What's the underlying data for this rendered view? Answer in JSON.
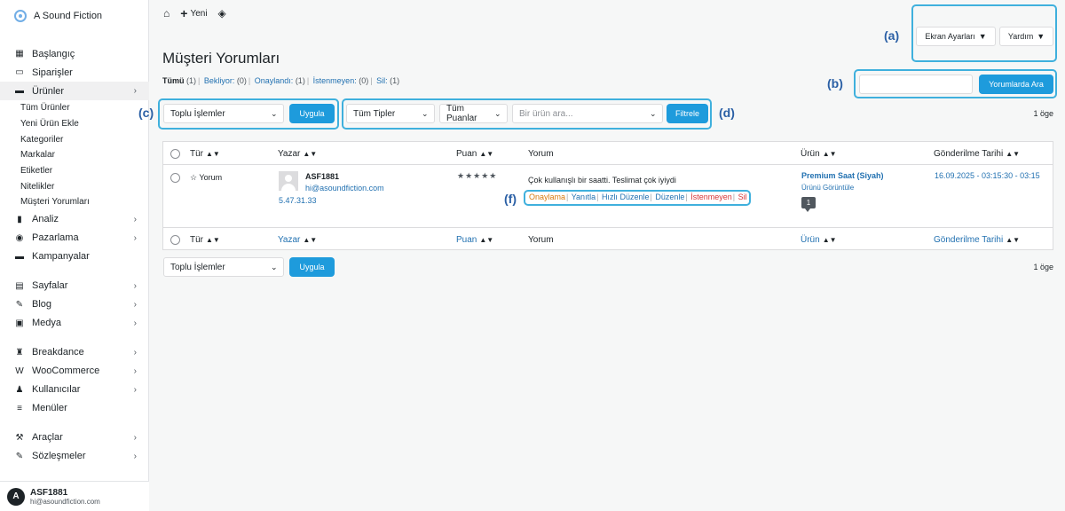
{
  "brand": {
    "name": "A Sound Fiction"
  },
  "sidebar": {
    "items": [
      {
        "label": "Başlangıç",
        "icon": "dashboard-icon",
        "glyph": "▦"
      },
      {
        "label": "Siparişler",
        "icon": "inbox-icon",
        "glyph": "▭"
      },
      {
        "label": "Ürünler",
        "icon": "archive-icon",
        "glyph": "▬"
      },
      {
        "label": "Analiz",
        "icon": "bar-chart-icon",
        "glyph": "▮"
      },
      {
        "label": "Pazarlama",
        "icon": "megaphone-icon",
        "glyph": "◉"
      },
      {
        "label": "Kampanyalar",
        "icon": "card-icon",
        "glyph": "▬"
      },
      {
        "label": "Sayfalar",
        "icon": "pages-icon",
        "glyph": "▤"
      },
      {
        "label": "Blog",
        "icon": "edit-icon",
        "glyph": "✎"
      },
      {
        "label": "Medya",
        "icon": "image-icon",
        "glyph": "▣"
      },
      {
        "label": "Breakdance",
        "icon": "breakdance-icon",
        "glyph": "♜"
      },
      {
        "label": "WooCommerce",
        "icon": "woocommerce-icon",
        "glyph": "W"
      },
      {
        "label": "Kullanıcılar",
        "icon": "users-icon",
        "glyph": "♟"
      },
      {
        "label": "Menüler",
        "icon": "menu-icon",
        "glyph": "≡"
      },
      {
        "label": "Araçlar",
        "icon": "wrench-icon",
        "glyph": "⚒"
      },
      {
        "label": "Sözleşmeler",
        "icon": "contract-icon",
        "glyph": "✎"
      }
    ],
    "submenu": [
      "Tüm Ürünler",
      "Yeni Ürün Ekle",
      "Kategoriler",
      "Markalar",
      "Etiketler",
      "Nitelikler",
      "Müşteri Yorumları"
    ]
  },
  "user": {
    "avatar_letter": "A",
    "name": "ASF1881",
    "email": "hi@asoundfiction.com"
  },
  "topbar": {
    "home_glyph": "⌂",
    "new_label": "Yeni",
    "breakdance_glyph": "◈"
  },
  "header_buttons": {
    "screen_options": "Ekran Ayarları",
    "help": "Yardım"
  },
  "page": {
    "title": "Müşteri Yorumları"
  },
  "status_links": {
    "all": "Tümü",
    "all_count": "(1)",
    "pending": "Bekliyor:",
    "pending_count": "(0)",
    "approved": "Onaylandı:",
    "approved_count": "(1)",
    "spam": "İstenmeyen:",
    "spam_count": "(0)",
    "trash": "Sil:",
    "trash_count": "(1)"
  },
  "search": {
    "placeholder": "",
    "button": "Yorumlarda Ara"
  },
  "bulk_actions": {
    "selected": "Toplu İşlemler",
    "apply": "Uygula"
  },
  "filters": {
    "type": "Tüm Tipler",
    "rating": "Tüm Puanlar",
    "product_placeholder": "Bir ürün ara...",
    "filter_button": "Filtrele"
  },
  "items_count": "1 öge",
  "annotations": {
    "a": "(a)",
    "b": "(b)",
    "c": "(c)",
    "d": "(d)",
    "f": "(f)"
  },
  "table": {
    "headers": {
      "type": "Tür",
      "author": "Yazar",
      "rating": "Puan",
      "review": "Yorum",
      "product": "Ürün",
      "date": "Gönderilme Tarihi"
    },
    "row": {
      "type": "☆ Yorum",
      "author_name": "ASF1881",
      "author_email": "hi@asoundfiction.com",
      "author_ip": "5.47.31.33",
      "rating": "★★★★★",
      "review_text": "Çok kullanışlı bir saatti. Teslimat çok iyiydi",
      "actions": {
        "approve": "Onaylama",
        "reply": "Yanıtla",
        "quick_edit": "Hızlı Düzenle",
        "edit": "Düzenle",
        "spam": "İstenmeyen",
        "trash": "Sil"
      },
      "product_name": "Premium Saat (Siyah)",
      "product_view": "Ürünü Görüntüle",
      "comment_count": "1",
      "date": "16.09.2025 - 03:15:30 - 03:15"
    }
  },
  "colors": {
    "accent": "#1e9bdc",
    "highlight_border": "#3fb0dd",
    "annotation_text": "#2a5fa5",
    "link": "#2271b1",
    "warning": "#d8790e",
    "danger": "#d63638"
  }
}
